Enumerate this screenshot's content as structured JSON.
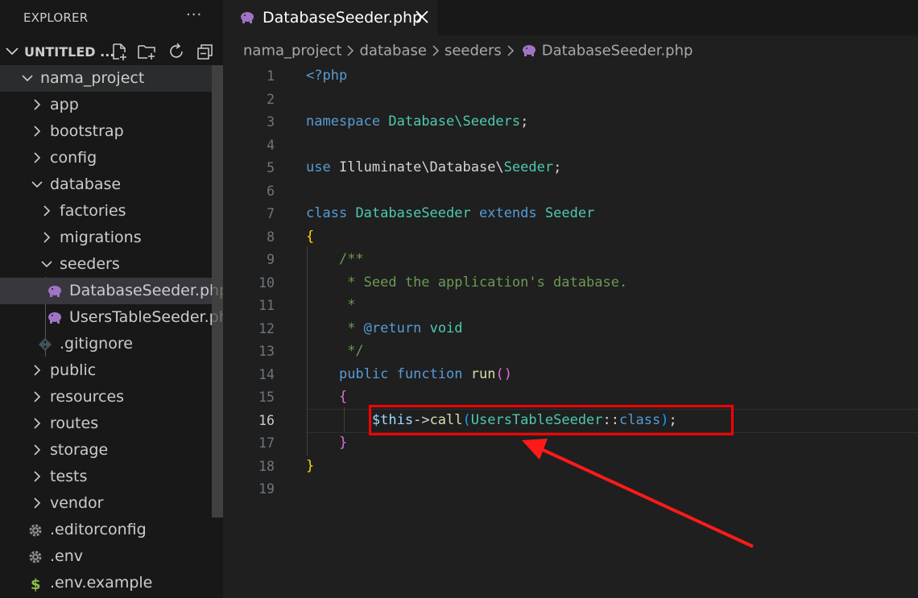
{
  "sidebar": {
    "explorer_title": "EXPLORER",
    "more_label": "···",
    "section_title": "UNTITLED ...",
    "tree": [
      {
        "label": "nama_project",
        "type": "folder-open"
      },
      {
        "label": "app",
        "type": "folder"
      },
      {
        "label": "bootstrap",
        "type": "folder"
      },
      {
        "label": "config",
        "type": "folder"
      },
      {
        "label": "database",
        "type": "folder-open"
      },
      {
        "label": "factories",
        "type": "folder"
      },
      {
        "label": "migrations",
        "type": "folder"
      },
      {
        "label": "seeders",
        "type": "folder-open"
      },
      {
        "label": "DatabaseSeeder.php",
        "type": "php-file"
      },
      {
        "label": "UsersTableSeeder.php",
        "type": "php-file"
      },
      {
        "label": ".gitignore",
        "type": "git-file"
      },
      {
        "label": "public",
        "type": "folder"
      },
      {
        "label": "resources",
        "type": "folder"
      },
      {
        "label": "routes",
        "type": "folder"
      },
      {
        "label": "storage",
        "type": "folder"
      },
      {
        "label": "tests",
        "type": "folder"
      },
      {
        "label": "vendor",
        "type": "folder"
      },
      {
        "label": ".editorconfig",
        "type": "gear-file"
      },
      {
        "label": ".env",
        "type": "gear-file"
      },
      {
        "label": ".env.example",
        "type": "dollar-file"
      }
    ]
  },
  "editor": {
    "tab_label": "DatabaseSeeder.php",
    "breadcrumb": [
      "nama_project",
      "database",
      "seeders",
      "DatabaseSeeder.php"
    ],
    "active_line": 16,
    "line_numbers": [
      "1",
      "2",
      "3",
      "4",
      "5",
      "6",
      "7",
      "8",
      "9",
      "10",
      "11",
      "12",
      "13",
      "14",
      "15",
      "16",
      "17",
      "18",
      "19"
    ],
    "code": {
      "l1": "<?php",
      "l3_kw": "namespace",
      "l3_ns": "Database\\Seeders",
      "l3_end": ";",
      "l5_kw": "use",
      "l5_ns1": "Illuminate\\Database\\",
      "l5_ns2": "Seeder",
      "l5_end": ";",
      "l7_kw": "class",
      "l7_name": "DatabaseSeeder",
      "l7_kw2": "extends",
      "l7_parent": "Seeder",
      "l8": "{",
      "l9": "/**",
      "l10": " * Seed the application's database.",
      "l11": " *",
      "l12_pre": " * ",
      "l12_tag": "@return",
      "l12_type": "void",
      "l13": " */",
      "l14_kw": "public",
      "l14_kw2": "function",
      "l14_fn": "run",
      "l14_par": "()",
      "l15": "{",
      "l16_var": "$this",
      "l16_op": "->",
      "l16_fn": "call",
      "l16_po": "(",
      "l16_cls": "UsersTableSeeder",
      "l16_dc": "::",
      "l16_kw": "class",
      "l16_pc": ")",
      "l16_end": ";",
      "l17": "}",
      "l18": "}"
    }
  },
  "colors": {
    "annotation": "#ff0000",
    "php_icon": "#a074c4",
    "keyword": "#569cd6",
    "type": "#4ec9b0",
    "comment": "#6a9955"
  }
}
